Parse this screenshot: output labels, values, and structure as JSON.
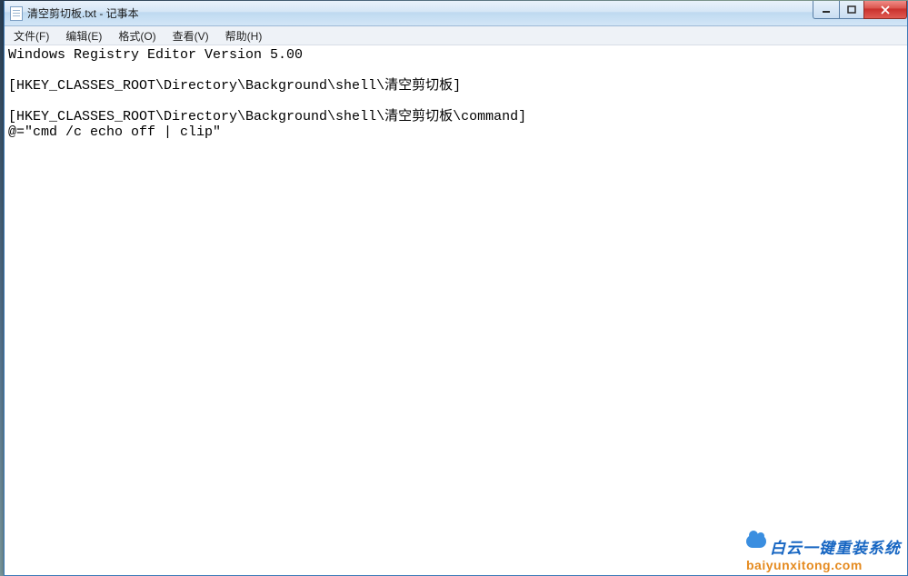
{
  "window": {
    "title": "清空剪切板.txt - 记事本"
  },
  "menu": {
    "file": "文件(F)",
    "edit": "编辑(E)",
    "format": "格式(O)",
    "view": "查看(V)",
    "help": "帮助(H)"
  },
  "editor": {
    "content": "Windows Registry Editor Version 5.00\n\n[HKEY_CLASSES_ROOT\\Directory\\Background\\shell\\清空剪切板]\n\n[HKEY_CLASSES_ROOT\\Directory\\Background\\shell\\清空剪切板\\command]\n@=\"cmd /c echo off | clip\""
  },
  "watermark": {
    "brand": "白云一键重装系统",
    "url": "baiyunxitong.com"
  },
  "icons": {
    "minimize": "minimize-icon",
    "maximize": "maximize-icon",
    "close": "close-icon",
    "document": "document-icon"
  }
}
